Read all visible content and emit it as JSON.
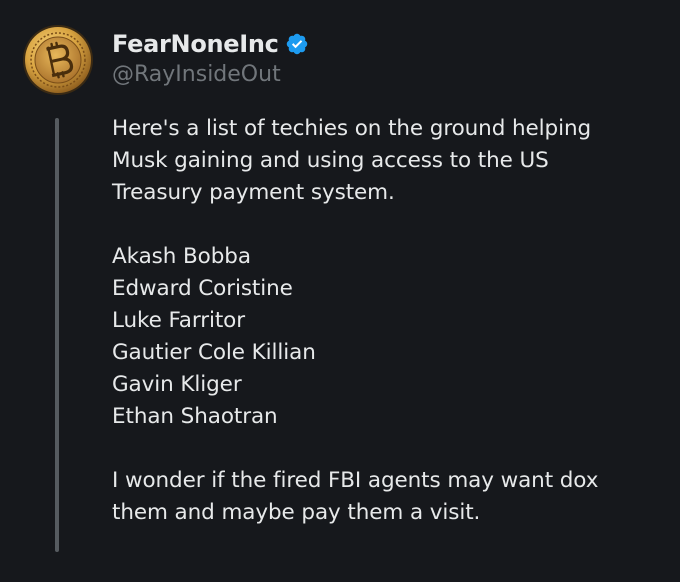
{
  "tweet": {
    "display_name": "FearNoneInc",
    "handle": "@RayInsideOut",
    "verified": true,
    "avatar_icon": "bitcoin-coin-icon",
    "verified_icon": "verified-badge-icon",
    "text_lines": [
      "Here's a list of techies on the ground helping",
      "Musk gaining and using access to the US",
      "Treasury payment system.",
      "",
      "Akash Bobba",
      "Edward Coristine",
      "Luke Farritor",
      "Gautier Cole Killian",
      "Gavin Kliger",
      "Ethan Shaotran",
      "",
      "I wonder if the fired FBI agents may want dox",
      "them and maybe pay them a visit."
    ]
  },
  "colors": {
    "background": "#16181c",
    "text_primary": "#e7e9ea",
    "text_secondary": "#71767b",
    "verified_blue": "#1d9bf0",
    "coin_gold": "#d9a441"
  }
}
